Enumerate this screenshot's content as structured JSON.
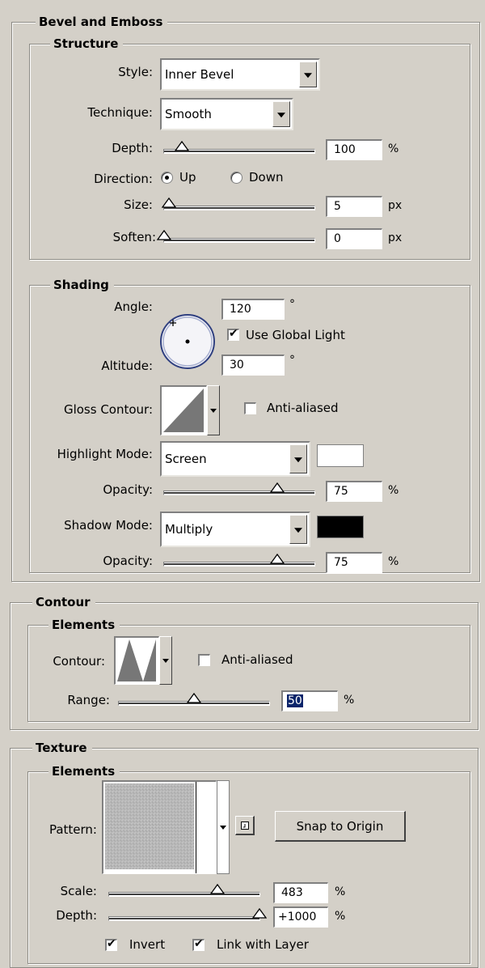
{
  "bevel": {
    "title": "Bevel and Emboss",
    "structure": {
      "title": "Structure",
      "style_label": "Style:",
      "style_value": "Inner Bevel",
      "technique_label": "Technique:",
      "technique_value": "Smooth",
      "depth_label": "Depth:",
      "depth_value": "100",
      "depth_unit": "%",
      "depth_slider": 0.12,
      "direction_label": "Direction:",
      "direction_up": "Up",
      "direction_down": "Down",
      "direction_selected": "Up",
      "size_label": "Size:",
      "size_value": "5",
      "size_unit": "px",
      "size_slider": 0.03,
      "soften_label": "Soften:",
      "soften_value": "0",
      "soften_unit": "px",
      "soften_slider": 0.0
    },
    "shading": {
      "title": "Shading",
      "angle_label": "Angle:",
      "angle_value": "120",
      "angle_unit": "°",
      "use_global_light_label": "Use Global Light",
      "use_global_light": true,
      "altitude_label": "Altitude:",
      "altitude_value": "30",
      "altitude_unit": "°",
      "gloss_contour_label": "Gloss Contour:",
      "gloss_anti_aliased_label": "Anti-aliased",
      "gloss_anti_aliased": false,
      "highlight_mode_label": "Highlight Mode:",
      "highlight_mode_value": "Screen",
      "highlight_color": "#ffffff",
      "highlight_opacity_label": "Opacity:",
      "highlight_opacity_value": "75",
      "highlight_opacity_unit": "%",
      "highlight_opacity_slider": 0.75,
      "shadow_mode_label": "Shadow Mode:",
      "shadow_mode_value": "Multiply",
      "shadow_color": "#000000",
      "shadow_opacity_label": "Opacity:",
      "shadow_opacity_value": "75",
      "shadow_opacity_unit": "%",
      "shadow_opacity_slider": 0.75
    }
  },
  "contour": {
    "title": "Contour",
    "elements_title": "Elements",
    "contour_label": "Contour:",
    "anti_aliased_label": "Anti-aliased",
    "anti_aliased": false,
    "range_label": "Range:",
    "range_value": "50",
    "range_unit": "%",
    "range_slider": 0.5
  },
  "texture": {
    "title": "Texture",
    "elements_title": "Elements",
    "pattern_label": "Pattern:",
    "snap_button": "Snap to Origin",
    "scale_label": "Scale:",
    "scale_value": "483",
    "scale_unit": "%",
    "scale_slider": 0.72,
    "depth_label": "Depth:",
    "depth_value": "+1000",
    "depth_unit": "%",
    "depth_slider": 1.0,
    "invert_label": "Invert",
    "invert": true,
    "link_label": "Link with Layer",
    "link": true
  }
}
